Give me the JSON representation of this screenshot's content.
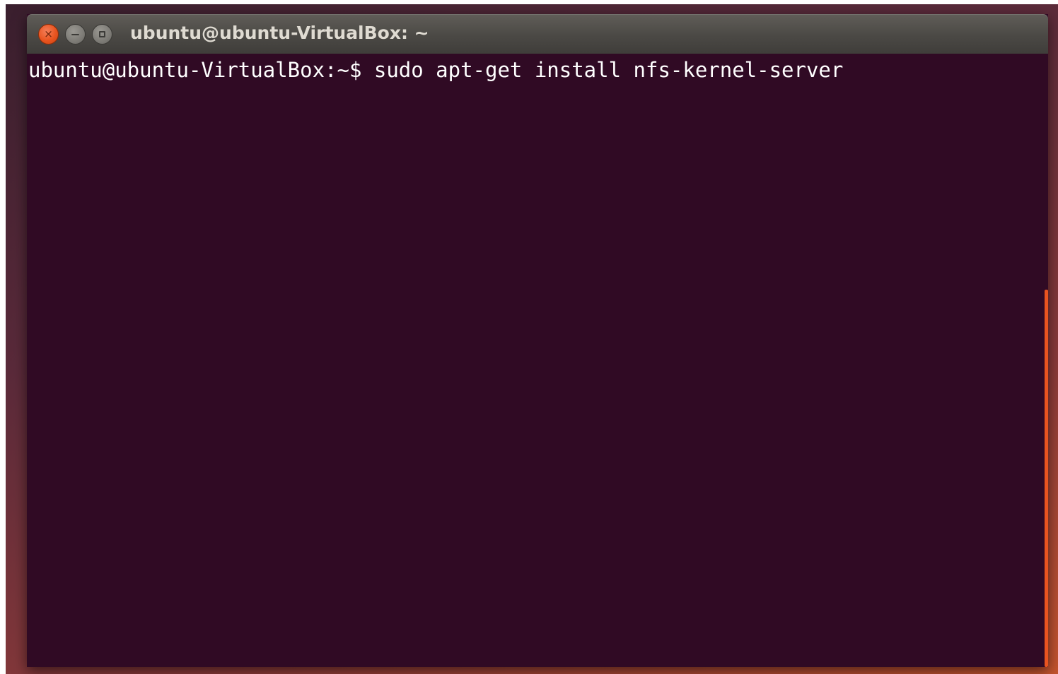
{
  "window": {
    "title": "ubuntu@ubuntu-VirtualBox: ~",
    "buttons": {
      "close_glyph": "×",
      "close_icon": "close-icon",
      "minimize_icon": "minimize-icon",
      "maximize_icon": "maximize-icon"
    }
  },
  "terminal": {
    "prompt": "ubuntu@ubuntu-VirtualBox:~$",
    "command": "sudo apt-get install nfs-kernel-server"
  },
  "colors": {
    "terminal_background": "#300a24",
    "accent": "#e95420",
    "text": "#ffffff"
  }
}
